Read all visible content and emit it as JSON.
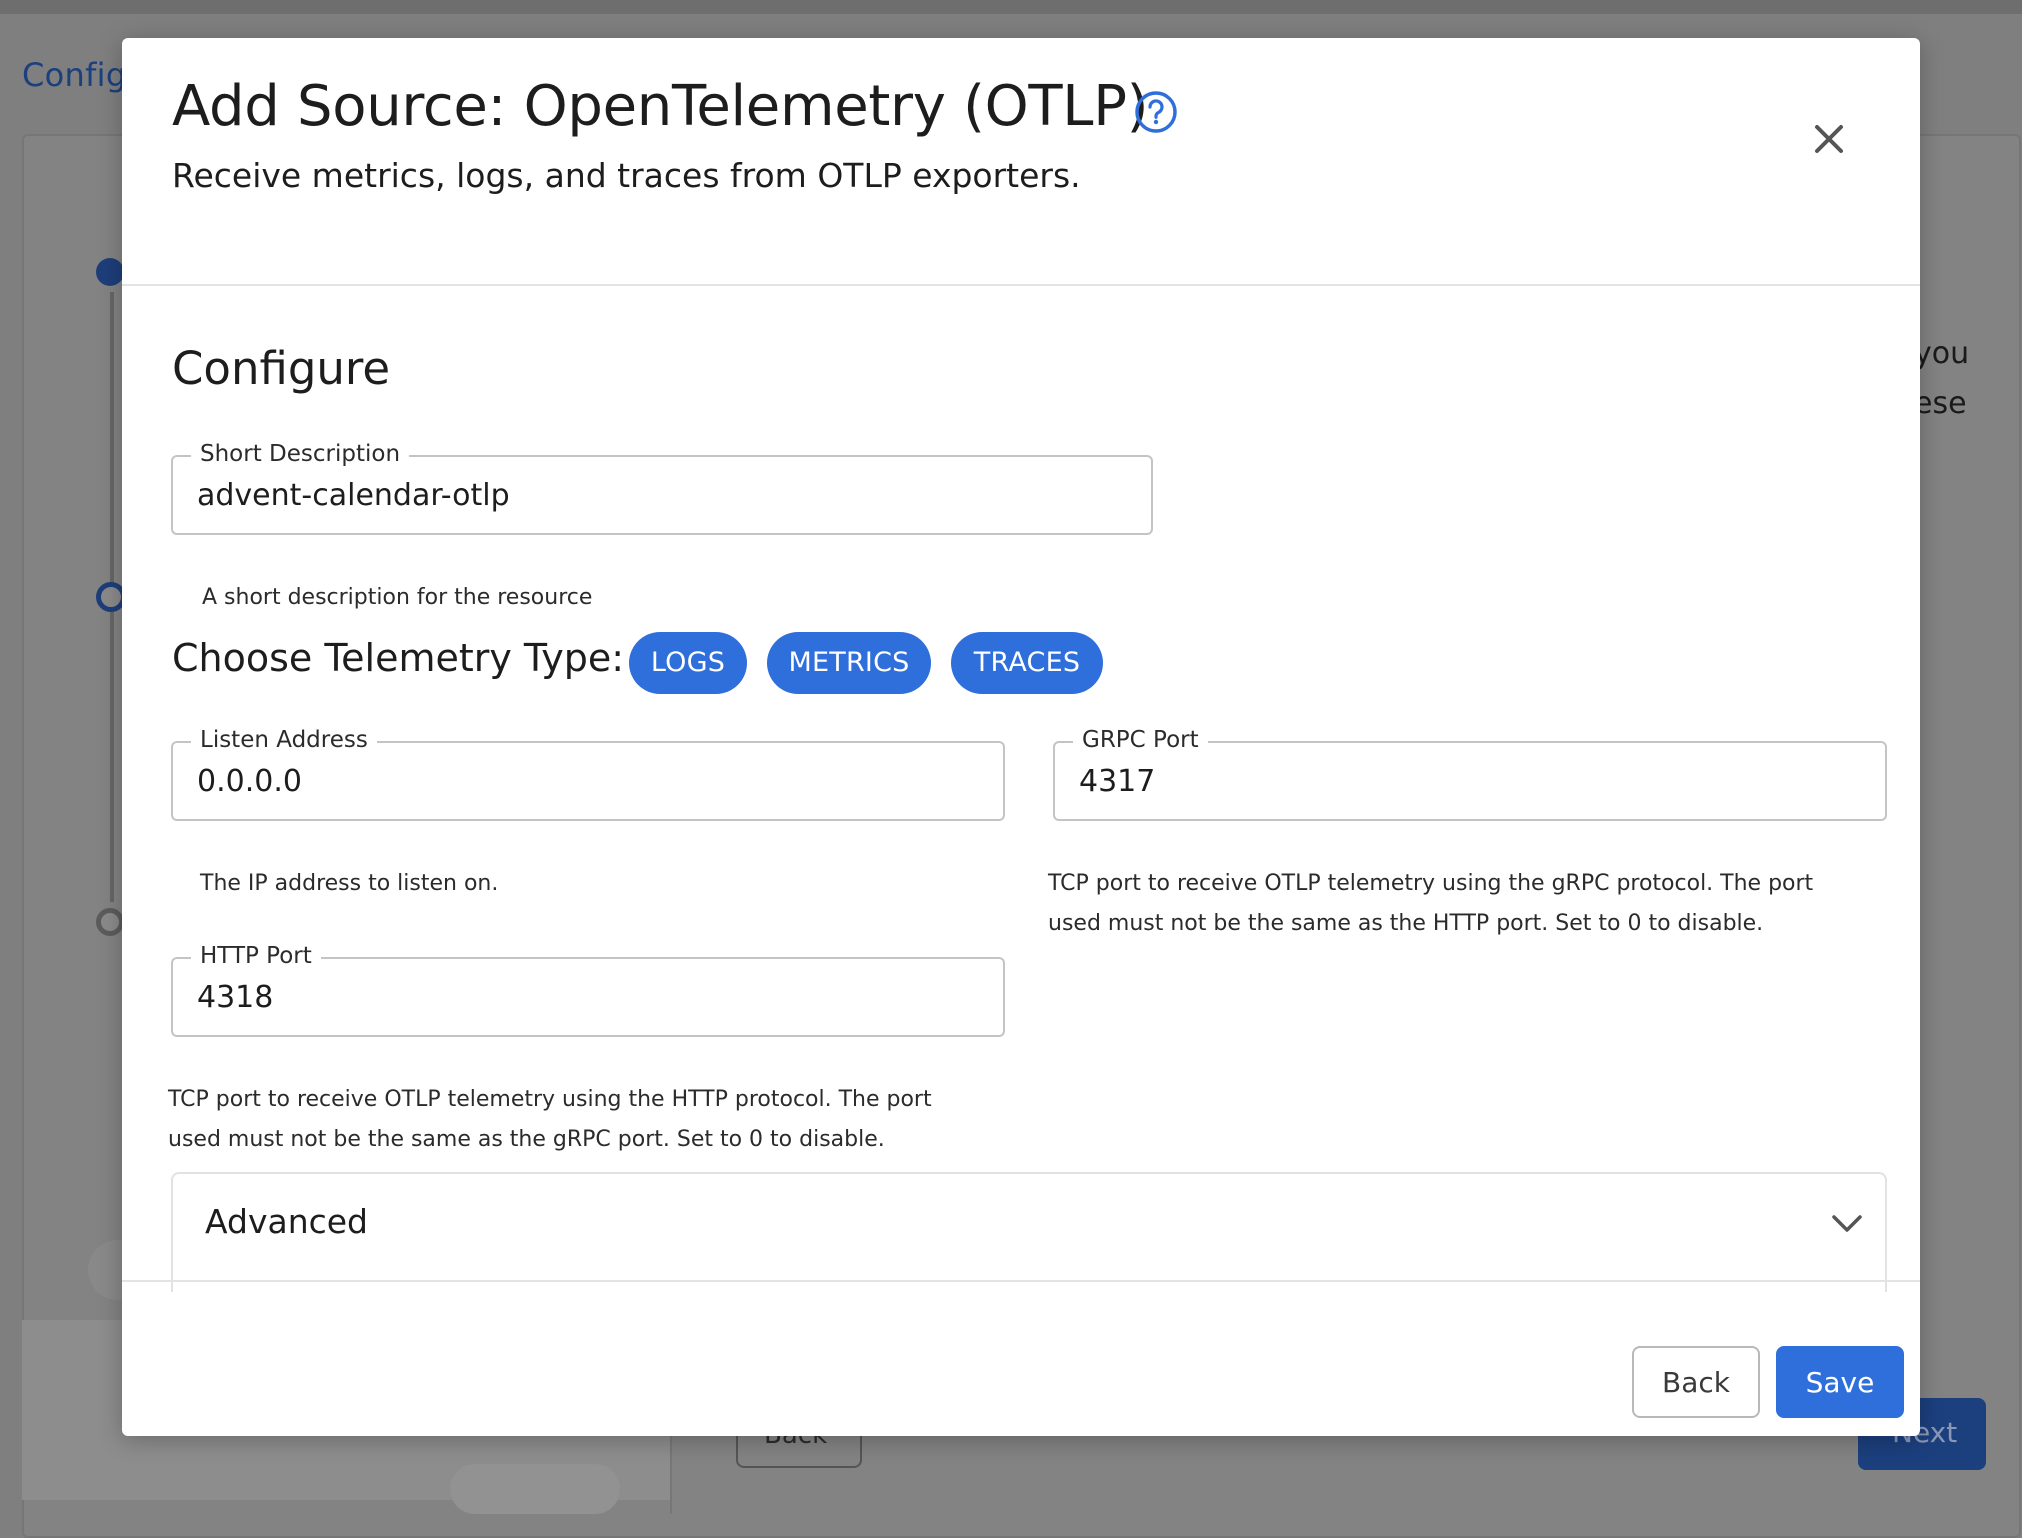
{
  "background": {
    "page_title": "Configu",
    "text_line_1": "you",
    "text_line_2": "ese",
    "back_label": "Back",
    "next_label": "Next"
  },
  "modal": {
    "title": "Add Source: OpenTelemetry (OTLP)",
    "subtitle": "Receive metrics, logs, and traces from OTLP exporters.",
    "section_title": "Configure",
    "short_description": {
      "label": "Short Description",
      "value": "advent-calendar-otlp",
      "helper": "A short description for the resource"
    },
    "telemetry": {
      "label": "Choose Telemetry Type:",
      "types": [
        "LOGS",
        "METRICS",
        "TRACES"
      ]
    },
    "listen_address": {
      "label": "Listen Address",
      "value": "0.0.0.0",
      "helper": "The IP address to listen on."
    },
    "grpc_port": {
      "label": "GRPC Port",
      "value": "4317",
      "helper": "TCP port to receive OTLP telemetry using the gRPC protocol. The port used must not be the same as the HTTP port. Set to 0 to disable."
    },
    "http_port": {
      "label": "HTTP Port",
      "value": "4318",
      "helper": "TCP port to receive OTLP telemetry using the HTTP protocol. The port used must not be the same as the gRPC port. Set to 0 to disable."
    },
    "advanced_label": "Advanced",
    "back_label": "Back",
    "save_label": "Save"
  },
  "colors": {
    "accent": "#2f6fdb",
    "overlay": "#7f7f7f"
  },
  "icons": {
    "help": "help-circle-icon",
    "close": "close-icon",
    "expand": "chevron-down-icon"
  }
}
